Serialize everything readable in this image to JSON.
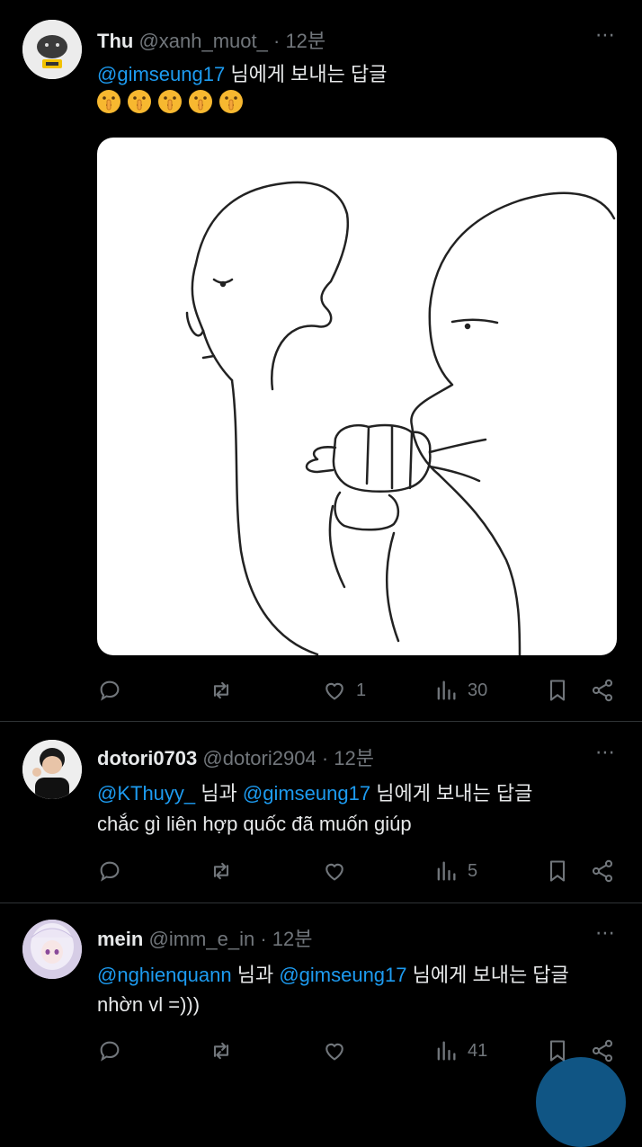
{
  "tweets": [
    {
      "name": "Thu",
      "handle": "@xanh_muot_",
      "time": "· 12분",
      "reply_to": [
        "@gimseung17"
      ],
      "reply_joiner": "",
      "reply_suffix": "님에게 보내는 답글",
      "text": "",
      "emoji": [
        "shushing-face",
        "shushing-face",
        "shushing-face",
        "shushing-face",
        "shushing-face"
      ],
      "reply_count": "",
      "retweet_count": "",
      "like_count": "1",
      "view_count": "30"
    },
    {
      "name": "dotori0703",
      "handle": "@dotori2904",
      "time": "· 12분",
      "reply_to": [
        "@KThuyy_",
        "@gimseung17"
      ],
      "reply_joiner": "님과",
      "reply_suffix": "님에게 보내는 답글",
      "text": "chắc gì liên hợp quốc đã muốn giúp",
      "reply_count": "",
      "retweet_count": "",
      "like_count": "",
      "view_count": "5"
    },
    {
      "name": "mein",
      "handle": "@imm_e_in",
      "time": "· 12분",
      "reply_to": [
        "@nghienquann",
        "@gimseung17"
      ],
      "reply_joiner": "님과",
      "reply_suffix": "님에게 보내는 답글",
      "text": "nhờn vl =)))",
      "reply_count": "",
      "retweet_count": "",
      "like_count": "",
      "view_count": "41"
    }
  ],
  "icons": {
    "reply": "speech-bubble-icon",
    "retweet": "retweet-icon",
    "like": "heart-icon",
    "views": "bar-chart-icon",
    "bookmark": "bookmark-icon",
    "share": "share-icon",
    "more": "more-dots-icon"
  },
  "colors": {
    "background": "#000000",
    "text": "#e7e9ea",
    "muted": "#71767b",
    "accent": "#1d9bf0",
    "divider": "#2f3336"
  },
  "more_label": "⋯"
}
